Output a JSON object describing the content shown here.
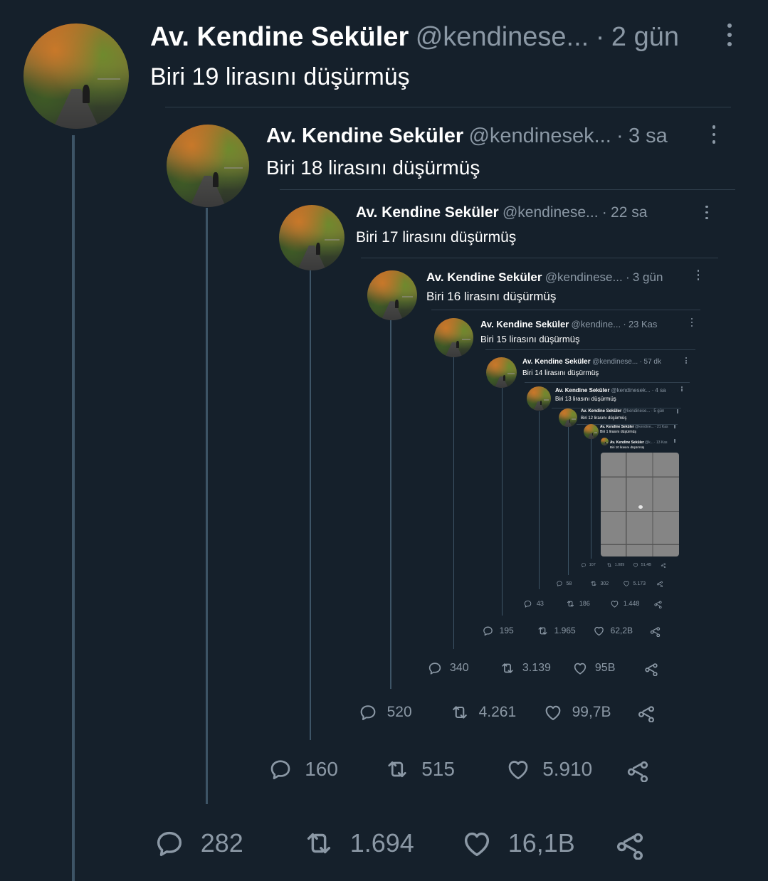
{
  "user": {
    "name": "Av. Kendine Seküler"
  },
  "tweets": [
    {
      "handle": "@kendinese...",
      "time": "2 gün",
      "text": "Biri 19 lirasını düşürmüş",
      "replies": "282",
      "retweets": "1.694",
      "likes": "16,1B"
    },
    {
      "handle": "@kendinesek...",
      "time": "3 sa",
      "text": "Biri 18 lirasını düşürmüş",
      "replies": "160",
      "retweets": "515",
      "likes": "5.910"
    },
    {
      "handle": "@kendinese...",
      "time": "22 sa",
      "text": "Biri 17 lirasını düşürmüş",
      "replies": "520",
      "retweets": "4.261",
      "likes": "99,7B"
    },
    {
      "handle": "@kendinese...",
      "time": "3 gün",
      "text": "Biri 16 lirasını düşürmüş",
      "replies": "340",
      "retweets": "3.139",
      "likes": "95B"
    },
    {
      "handle": "@kendine...",
      "time": "23 Kas",
      "text": "Biri 15 lirasını düşürmüş",
      "replies": "195",
      "retweets": "1.965",
      "likes": "62,2B"
    },
    {
      "handle": "@kendinese...",
      "time": "57 dk",
      "text": "Biri 14 lirasını düşürmüş",
      "replies": "43",
      "retweets": "186",
      "likes": "1.448"
    },
    {
      "handle": "@kendinesek...",
      "time": "4 sa",
      "text": "Biri 13 lirasını düşürmüş",
      "replies": "58",
      "retweets": "302",
      "likes": "5.173"
    },
    {
      "handle": "@kendinese...",
      "time": "5 gün",
      "text": "Biri 12 lirasını düşürmüş",
      "replies": "107",
      "retweets": "1.089",
      "likes": "51,4B"
    },
    {
      "handle": "@kendine...",
      "time": "21 Kas",
      "text": "Biri 1 lirasını düşürmüş"
    },
    {
      "handle": "@k...",
      "time": "13 Kas",
      "text": "Biri 10 lirasını düşürmüş"
    }
  ],
  "icons": [
    "reply-icon",
    "retweet-icon",
    "like-icon",
    "share-icon",
    "more-icon"
  ],
  "colors": {
    "background": "#15202b",
    "text": "#ffffff",
    "secondary": "#8b98a5",
    "thread_line": "#3d5466"
  }
}
